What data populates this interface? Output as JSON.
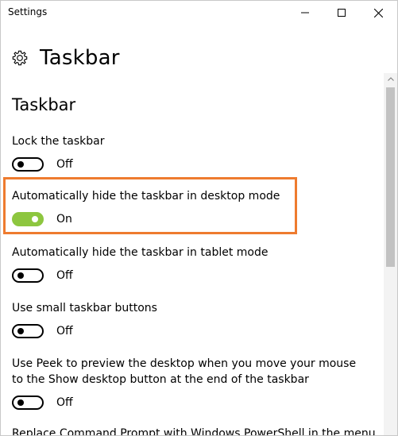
{
  "window": {
    "app_title": "Settings",
    "controls": {
      "minimize": "minimize-icon",
      "maximize": "maximize-icon",
      "close": "close-icon"
    }
  },
  "header": {
    "icon": "gear-icon",
    "title": "Taskbar"
  },
  "section": {
    "title": "Taskbar"
  },
  "settings": [
    {
      "label": "Lock the taskbar",
      "state": "Off",
      "on": false
    },
    {
      "label": "Automatically hide the taskbar in desktop mode",
      "state": "On",
      "on": true,
      "highlighted": true
    },
    {
      "label": "Automatically hide the taskbar in tablet mode",
      "state": "Off",
      "on": false
    },
    {
      "label": "Use small taskbar buttons",
      "state": "Off",
      "on": false
    },
    {
      "label": "Use Peek to preview the desktop when you move your mouse to the Show desktop button at the end of the taskbar",
      "state": "Off",
      "on": false
    }
  ],
  "cutoff_text": "Replace Command Prompt with Windows PowerShell in the menu",
  "colors": {
    "toggle_on": "#8dc63f",
    "highlight": "#ee7b2f",
    "scroll_thumb": "#c2c2c2"
  }
}
